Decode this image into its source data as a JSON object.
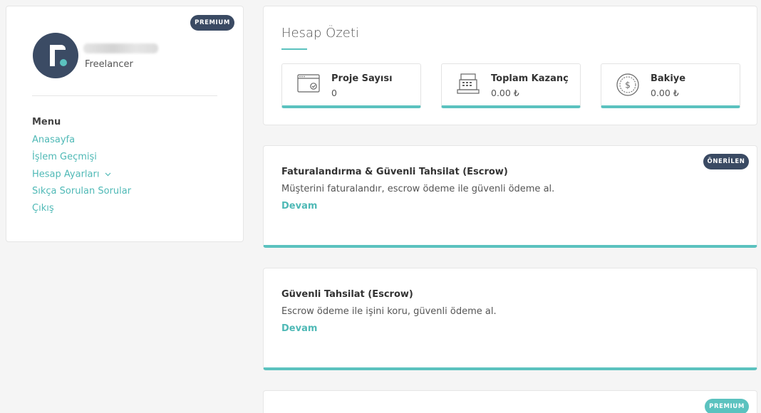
{
  "profile": {
    "badge": "PREMIUM",
    "role": "Freelancer"
  },
  "menu": {
    "title": "Menu",
    "items": [
      {
        "label": "Anasayfa"
      },
      {
        "label": "İşlem Geçmişi"
      },
      {
        "label": "Hesap Ayarları"
      },
      {
        "label": "Sıkça Sorulan Sorular"
      },
      {
        "label": "Çıkış"
      }
    ]
  },
  "summary": {
    "title": "Hesap Özeti",
    "stats": [
      {
        "label": "Proje Sayısı",
        "value": "0",
        "icon": "browser-window-icon"
      },
      {
        "label": "Toplam Kazanç",
        "value": "0.00 ₺",
        "icon": "cash-register-icon"
      },
      {
        "label": "Bakiye",
        "value": "0.00 ₺",
        "icon": "dollar-coin-icon"
      }
    ]
  },
  "offers": [
    {
      "badge": "ÖNERİLEN",
      "title": "Faturalandırma & Güvenli Tahsilat (Escrow)",
      "description": "Müşterini faturalandır, escrow ödeme ile güvenli ödeme al.",
      "link": "Devam"
    },
    {
      "title": "Güvenli Tahsilat (Escrow)",
      "description": "Escrow ödeme ile işini koru, güvenli ödeme al.",
      "link": "Devam"
    },
    {
      "badge": "PREMIUM"
    }
  ],
  "colors": {
    "accent": "#5bc2bf",
    "link": "#4fb9b6",
    "badge_dark": "#3a4a63",
    "background": "#f5f5f5"
  }
}
